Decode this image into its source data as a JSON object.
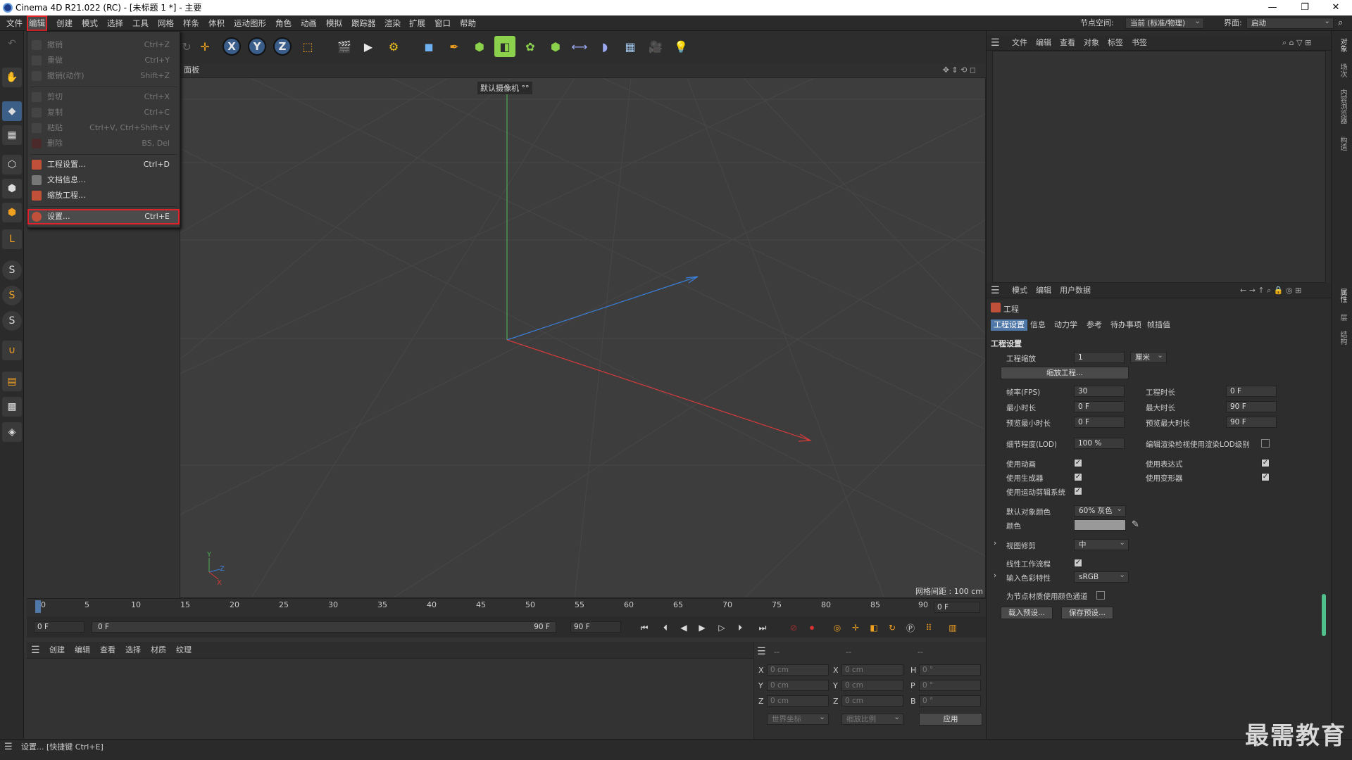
{
  "window": {
    "title": "Cinema 4D R21.022 (RC) - [未标题 1 *] - 主要"
  },
  "menubar": {
    "items": [
      "文件",
      "编辑",
      "模式",
      "选择",
      "工具",
      "网格",
      "样条",
      "体积",
      "运动图形",
      "角色",
      "动画",
      "模拟",
      "跟踪器",
      "渲染",
      "扩展",
      "窗口",
      "帮助"
    ],
    "node_space_label": "节点空间:",
    "node_space_value": "当前 (标准/物理)",
    "layout_label": "界面:",
    "layout_value": "启动"
  },
  "edit_menu": {
    "items": [
      {
        "label": "撤销",
        "shortcut": "Ctrl+Z",
        "disabled": true
      },
      {
        "label": "重做",
        "shortcut": "Ctrl+Y",
        "disabled": true
      },
      {
        "label": "撤销(动作)",
        "shortcut": "Shift+Z",
        "disabled": true
      },
      {
        "label": "剪切",
        "shortcut": "Ctrl+X",
        "disabled": true
      },
      {
        "label": "复制",
        "shortcut": "Ctrl+C",
        "disabled": true
      },
      {
        "label": "粘贴",
        "shortcut": "Ctrl+V, Ctrl+Shift+V",
        "disabled": true
      },
      {
        "label": "删除",
        "shortcut": "BS, Del",
        "disabled": true
      },
      {
        "label": "工程设置...",
        "shortcut": "Ctrl+D",
        "disabled": false
      },
      {
        "label": "文档信息...",
        "shortcut": "",
        "disabled": false
      },
      {
        "label": "缩放工程...",
        "shortcut": "",
        "disabled": false
      },
      {
        "label": "设置...",
        "shortcut": "Ctrl+E",
        "disabled": false,
        "highlighted": true
      }
    ]
  },
  "viewport": {
    "panel_label": "面板",
    "camera_label": "默认摄像机 °°",
    "grid_spacing": "网格间距 : 100 cm"
  },
  "timeline": {
    "ticks": [
      "0",
      "5",
      "10",
      "15",
      "20",
      "25",
      "30",
      "35",
      "40",
      "45",
      "50",
      "55",
      "60",
      "65",
      "70",
      "75",
      "80",
      "85",
      "90"
    ],
    "current_frame": "0 F",
    "start_frame": "0 F",
    "range_start": "0 F",
    "range_end": "90 F",
    "end_frame": "90 F"
  },
  "material_bar": {
    "items": [
      "创建",
      "编辑",
      "查看",
      "选择",
      "材质",
      "纹理"
    ]
  },
  "coord_panel": {
    "headers": [
      "--",
      "--",
      "--"
    ],
    "rows": [
      {
        "a": "X",
        "av": "0 cm",
        "b": "X",
        "bv": "0 cm",
        "c": "H",
        "cv": "0 °"
      },
      {
        "a": "Y",
        "av": "0 cm",
        "b": "Y",
        "bv": "0 cm",
        "c": "P",
        "cv": "0 °"
      },
      {
        "a": "Z",
        "av": "0 cm",
        "b": "Z",
        "bv": "0 cm",
        "c": "B",
        "cv": "0 °"
      }
    ],
    "mode_world": "世界坐标",
    "mode_scale": "缩放比例",
    "apply": "应用"
  },
  "object_manager": {
    "menu": [
      "文件",
      "编辑",
      "查看",
      "对象",
      "标签",
      "书签"
    ]
  },
  "attributes": {
    "menu": [
      "模式",
      "编辑",
      "用户数据"
    ],
    "object_name": "工程",
    "tabs": [
      "工程设置",
      "信息",
      "动力学",
      "参考",
      "待办事项",
      "帧插值"
    ],
    "section": "工程设置",
    "project_scale_label": "工程缩放",
    "project_scale_value": "1",
    "project_scale_unit": "厘米",
    "scale_button": "缩放工程...",
    "fps_label": "帧率(FPS)",
    "fps_value": "30",
    "duration_label": "工程时长",
    "duration_value": "0 F",
    "min_time_label": "最小时长",
    "min_time_value": "0 F",
    "max_time_label": "最大时长",
    "max_time_value": "90 F",
    "preview_min_label": "预览最小时长",
    "preview_min_value": "0 F",
    "preview_max_label": "预览最大时长",
    "preview_max_value": "90 F",
    "lod_label": "细节程度(LOD)",
    "lod_value": "100 %",
    "render_lod_label": "编辑渲染检视使用渲染LOD级别",
    "use_anim": "使用动画",
    "use_expr": "使用表达式",
    "use_gen": "使用生成器",
    "use_deform": "使用变形器",
    "use_motion": "使用运动剪辑系统",
    "default_color_label": "默认对象颜色",
    "default_color_value": "60% 灰色",
    "color_label": "颜色",
    "view_clip_label": "视图修剪",
    "view_clip_value": "中",
    "linear_label": "线性工作流程",
    "input_color_label": "输入色彩特性",
    "input_color_value": "sRGB",
    "node_color_label": "为节点材质使用颜色通道",
    "load_preset": "载入预设...",
    "save_preset": "保存预设..."
  },
  "right_sidebar": {
    "tabs": [
      "对象",
      "场次",
      "内容浏览器",
      "构造",
      "属性",
      "层",
      "结构"
    ]
  },
  "status": {
    "text": "设置... [快捷键 Ctrl+E]"
  },
  "watermark": "最需教育"
}
